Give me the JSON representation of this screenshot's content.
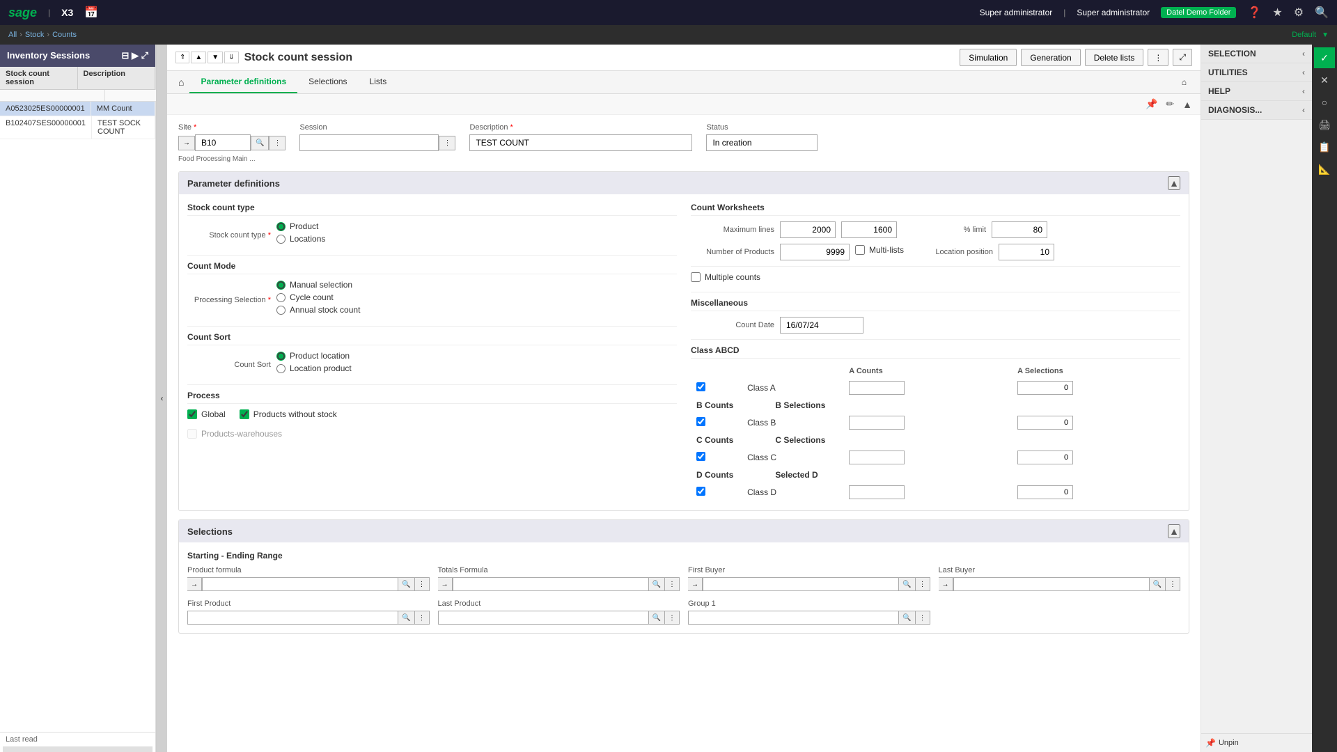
{
  "topNav": {
    "logo": "sage",
    "appCode": "X3",
    "calendarIcon": "📅",
    "userLabel1": "Super administrator",
    "userLabel2": "Super administrator",
    "folderLabel": "Datel Demo Folder",
    "helpIcon": "?",
    "starIcon": "★",
    "searchIcon": "🔍",
    "settingsIcon": "⚙"
  },
  "breadcrumb": {
    "all": "All",
    "stock": "Stock",
    "counts": "Counts",
    "defaultLabel": "Default"
  },
  "pageHeader": {
    "title": "Stock count session",
    "simulationBtn": "Simulation",
    "generationBtn": "Generation",
    "deleteListsBtn": "Delete lists",
    "moreBtn": "⋮"
  },
  "tabs": {
    "home": "⌂",
    "parameterDefinitions": "Parameter definitions",
    "selections": "Selections",
    "lists": "Lists"
  },
  "sidebarHeader": "Inventory Sessions",
  "sidebarCols": [
    "Stock count session",
    "Description"
  ],
  "sidebarRows": [
    {
      "session": "A0523025ES00000001",
      "description": "MM Count"
    },
    {
      "session": "B102407SES00000001",
      "description": "TEST SOCK COUNT"
    }
  ],
  "form": {
    "siteLabel": "Site",
    "siteRequired": true,
    "siteValue": "B10",
    "siteSubText": "Food Processing Main ...",
    "sessionLabel": "Session",
    "descriptionLabel": "Description",
    "descriptionRequired": true,
    "descriptionValue": "TEST COUNT",
    "statusLabel": "Status",
    "statusValue": "In creation"
  },
  "parameterDefinitions": {
    "title": "Parameter definitions",
    "stockCountType": {
      "sectionTitle": "Stock count type",
      "label": "Stock count type",
      "required": true,
      "options": [
        "Product",
        "Locations"
      ],
      "selected": "Product"
    },
    "countMode": {
      "sectionTitle": "Count Mode",
      "processingLabel": "Processing Selection",
      "required": true,
      "options": [
        "Manual selection",
        "Cycle count",
        "Annual stock count"
      ],
      "selected": "Manual selection"
    },
    "countSort": {
      "sectionTitle": "Count Sort",
      "label": "Count Sort",
      "options": [
        "Product location",
        "Location product"
      ],
      "selected": "Product location"
    },
    "process": {
      "sectionTitle": "Process",
      "globalLabel": "Global",
      "globalChecked": true,
      "productsWithoutStockLabel": "Products without stock",
      "productsWithoutStockChecked": true,
      "productsWarehousesLabel": "Products-warehouses",
      "productsWarehousesChecked": false,
      "productsWarehousesDisabled": true
    },
    "countWorksheets": {
      "sectionTitle": "Count Worksheets",
      "maximumLinesLabel": "Maximum lines",
      "maximumLinesValue1": "2000",
      "maximumLinesValue2": "1600",
      "percentLimitLabel": "% limit",
      "percentLimitValue": "80",
      "numberOfProductsLabel": "Number of Products",
      "numberOfProductsValue": "9999",
      "multiListsLabel": "Multi-lists",
      "multiListsChecked": false,
      "locationPositionLabel": "Location position",
      "locationPositionValue": "10"
    },
    "multipleCountsLabel": "Multiple counts",
    "multipleCountsChecked": false,
    "miscellaneous": {
      "sectionTitle": "Miscellaneous",
      "countDateLabel": "Count Date",
      "countDateValue": "16/07/24"
    },
    "classABCD": {
      "sectionTitle": "Class ABCD",
      "headers": [
        "",
        "",
        "A Counts",
        "A Selections"
      ],
      "classes": [
        {
          "id": "A",
          "label": "Class A",
          "checked": true,
          "countsLabel": "A Counts",
          "selectionsLabel": "A Selections",
          "countsValue": "",
          "selectionsValue": "0"
        },
        {
          "id": "B",
          "label": "Class B",
          "checked": true,
          "countsLabel": "B Counts",
          "selectionsLabel": "B Selections",
          "countsValue": "",
          "selectionsValue": "0"
        },
        {
          "id": "C",
          "label": "Class C",
          "checked": true,
          "countsLabel": "C Counts",
          "selectionsLabel": "C Selections",
          "countsValue": "",
          "selectionsValue": "0"
        },
        {
          "id": "D",
          "label": "Class D",
          "checked": true,
          "countsLabel": "D Counts",
          "selectionsLabel": "Selected D",
          "countsValue": "",
          "selectionsValue": "0"
        }
      ]
    }
  },
  "selections": {
    "title": "Selections",
    "startingEndingRange": "Starting - Ending Range",
    "fields": [
      {
        "label": "Product formula",
        "value": ""
      },
      {
        "label": "Totals Formula",
        "value": ""
      },
      {
        "label": "First Buyer",
        "value": ""
      },
      {
        "label": "Last Buyer",
        "value": ""
      }
    ],
    "fields2": [
      {
        "label": "First Product",
        "value": ""
      },
      {
        "label": "Last Product",
        "value": ""
      },
      {
        "label": "Group 1",
        "value": ""
      }
    ]
  },
  "rightPanel": {
    "selectionLabel": "SELECTION",
    "utilitiesLabel": "UTILITIES",
    "helpLabel": "HELP",
    "diagnosisLabel": "DIAGNOSIS..."
  },
  "farRightIcons": [
    "✕",
    "○",
    "🖨",
    "📋",
    "≡"
  ],
  "lastRead": "Last read",
  "unpinLabel": "Unpin"
}
